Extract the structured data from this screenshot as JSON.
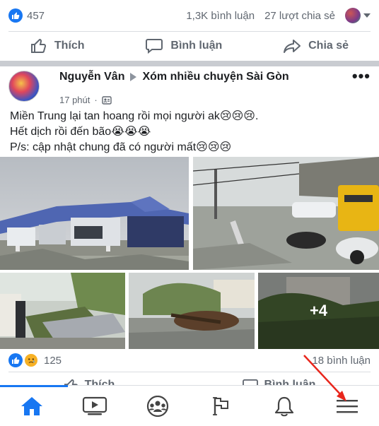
{
  "top_summary": {
    "like_count": "457",
    "comments": "1,3K bình luận",
    "shares": "27 lượt chia sẻ"
  },
  "top_actions": {
    "like": "Thích",
    "comment": "Bình luận",
    "share": "Chia sẻ"
  },
  "post": {
    "author": "Nguyễn Vân",
    "group": "Xóm nhiều chuyện Sài Gòn",
    "time": "17 phút",
    "more": "•••",
    "lines": [
      "Miền Trung lại tan hoang rồi mọi người ak😢😢😢.",
      "Hết dịch rồi đến bão😭😭😭",
      "P/s: cập nhật chung đã có người mất😢😢😢"
    ],
    "more_photos": "+4"
  },
  "bottom_summary": {
    "reaction_count": "125",
    "comments": "18 bình luận"
  },
  "bottom_actions": {
    "like": "Thích",
    "comment": "Bình luận"
  },
  "tabbar": {
    "items": [
      "home",
      "watch",
      "groups",
      "pages",
      "notifications",
      "menu"
    ],
    "active": "home"
  },
  "colors": {
    "accent": "#1877f2",
    "text": "#1c1e21",
    "muted": "#606770",
    "annotation_arrow": "#e8261c"
  }
}
